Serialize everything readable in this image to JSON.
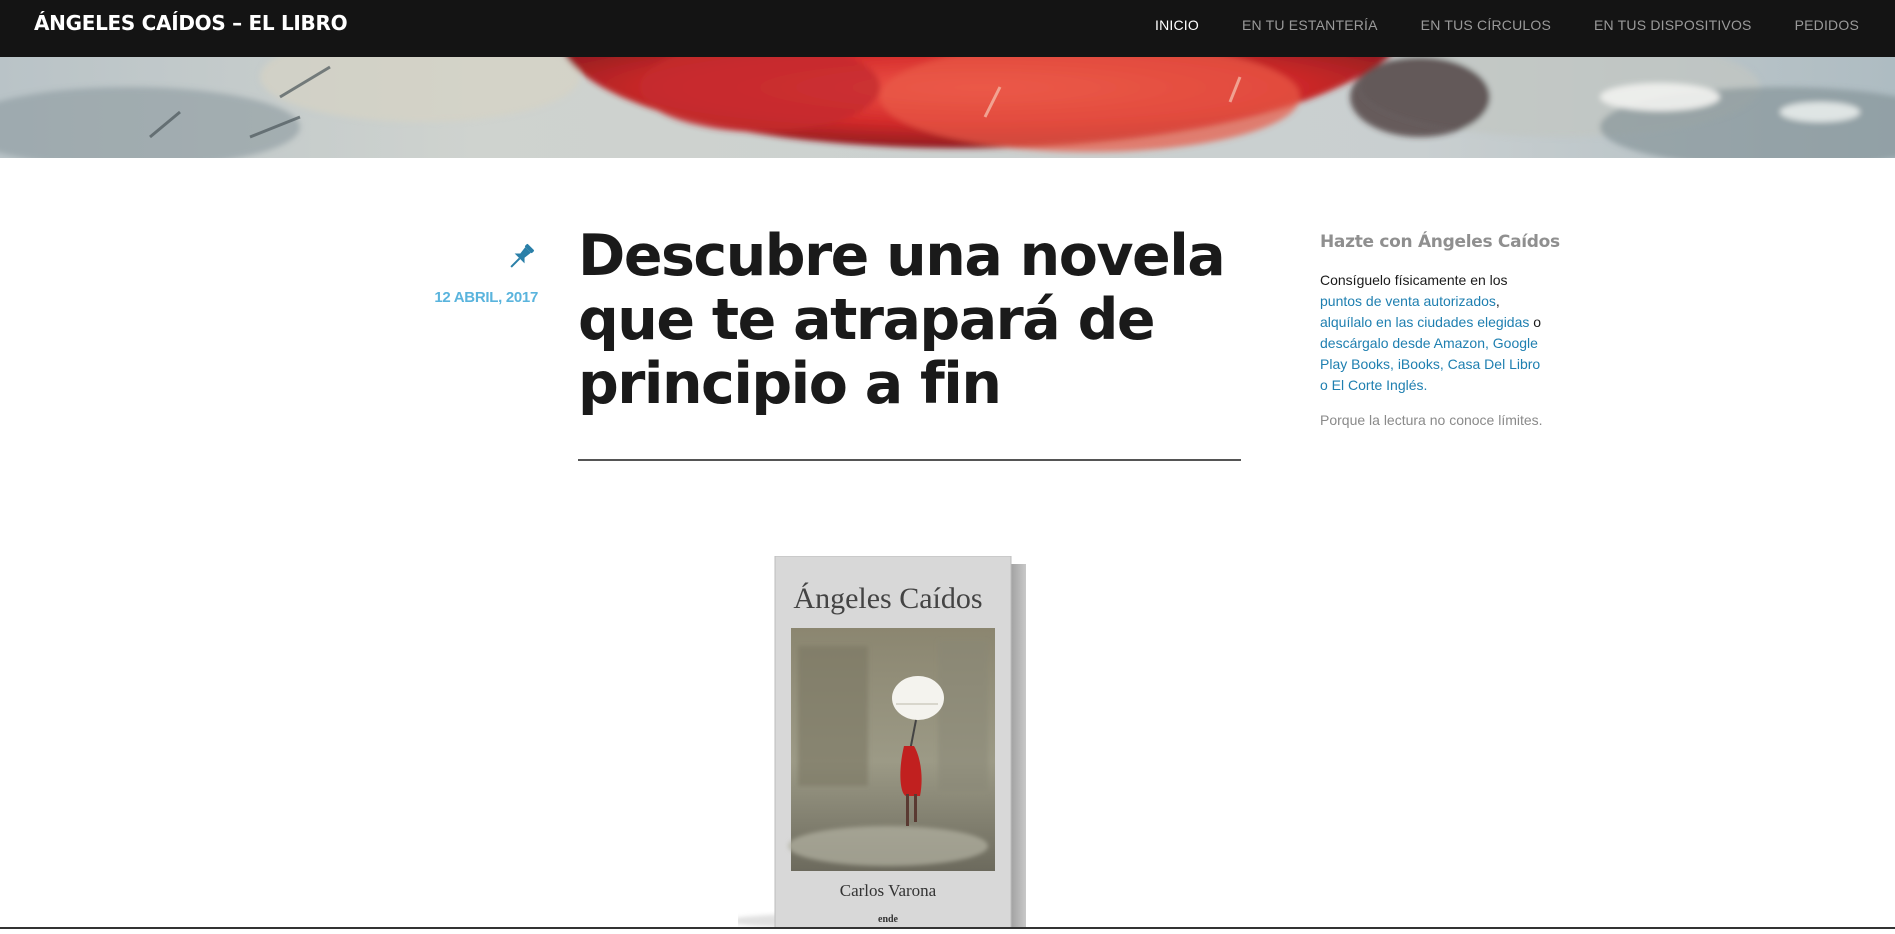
{
  "header": {
    "site_title": "ÁNGELES CAÍDOS – EL LIBRO",
    "nav": [
      {
        "label": "INICIO",
        "current": true
      },
      {
        "label": "EN TU ESTANTERÍA",
        "current": false
      },
      {
        "label": "EN TUS CÍRCULOS",
        "current": false
      },
      {
        "label": "EN TUS DISPOSITIVOS",
        "current": false
      },
      {
        "label": "PEDIDOS",
        "current": false
      }
    ]
  },
  "post": {
    "sticky_icon": "pushpin-icon",
    "date": "12 ABRIL, 2017",
    "title": "Descubre una novela que te atrapará de principio a fin",
    "book_cover": {
      "title": "Ángeles Caídos",
      "author": "Carlos Varona",
      "publisher": "ende"
    }
  },
  "sidebar": {
    "widget_title": "Hazte con Ángeles Caídos",
    "intro": "Consíguelo físicamente en los ",
    "link_points": "puntos de venta autorizados",
    "comma": ", ",
    "link_rent": "alquílalo en las ciudades elegidas",
    "or": " o ",
    "link_download": "descárgalo desde Amazon, Google Play Books, iBooks, Casa Del Libro o El Corte Inglés.",
    "note": "Porque la lectura no conoce límites."
  },
  "colors": {
    "topbar": "#141414",
    "accent_link": "#1e7fb0",
    "date": "#5ab4dd",
    "pin": "#2a7fa8"
  }
}
